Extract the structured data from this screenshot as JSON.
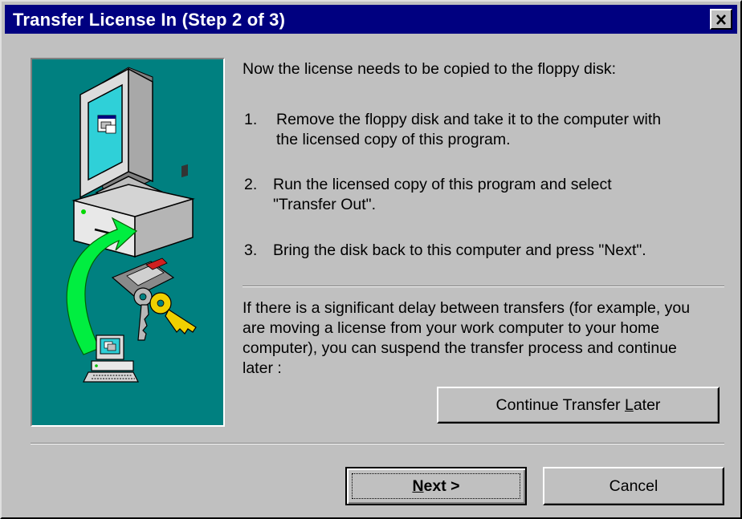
{
  "window": {
    "title": "Transfer License In (Step 2 of 3)",
    "close_icon": "close-x-icon"
  },
  "illustration": {
    "background_color": "#008080",
    "icons": [
      "computer-icon",
      "floppy-disk-icon",
      "key-icon",
      "green-arrow-icon",
      "small-computer-icon"
    ]
  },
  "content": {
    "intro": "Now the license needs to be copied to the floppy disk:",
    "steps": [
      {
        "num": "1.",
        "text": "Remove the floppy disk and take it to the computer with\nthe licensed copy of this program."
      },
      {
        "num": "2.",
        "text": "Run the licensed copy of this program and select\n\"Transfer Out\"."
      },
      {
        "num": "3.",
        "text": "Bring the disk back to this computer and press \"Next\"."
      }
    ],
    "delay_note": [
      "If there is a significant delay between transfers (for example, you",
      "are moving a license from your work computer to your home",
      "computer), you can suspend the transfer process and continue",
      "later :"
    ]
  },
  "buttons": {
    "continue_later": {
      "before": "Continue Transfer ",
      "mnemonic": "L",
      "after": "ater"
    },
    "next": {
      "before": "",
      "mnemonic": "N",
      "after": "ext >"
    },
    "cancel": {
      "label": "Cancel"
    }
  },
  "colors": {
    "face": "#c0c0c0",
    "title_bar": "#000080",
    "illustration_bg": "#008080"
  }
}
